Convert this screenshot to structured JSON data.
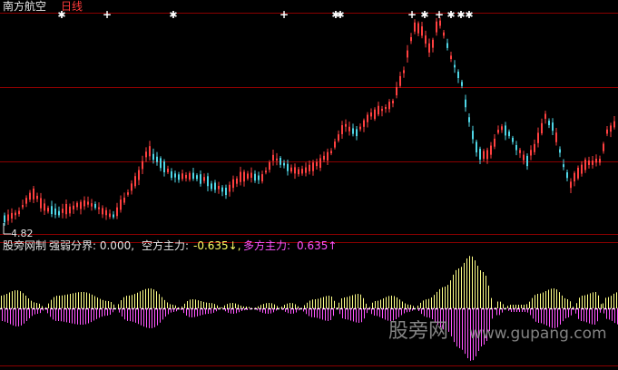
{
  "header": {
    "stock_name": "南方航空",
    "period": "日线"
  },
  "indicator": {
    "name": "股旁网制",
    "threshold_label": "强弱分界: 0.000,",
    "kong_label": "空方主力:",
    "kong_value": "-0.635↓,",
    "duo_label": "多方主力:",
    "duo_value": "0.635↑"
  },
  "price_low_label": "4.82",
  "watermark": {
    "text": "股旁网",
    "url": "www.gupang.com"
  },
  "colors": {
    "background": "#000000",
    "up_candle": "#ff4040",
    "down_candle": "#4fd6e6",
    "grid": "#8b0000",
    "kong_bars": "#ffff88",
    "duo_bars": "#ff55ff",
    "signal_marks": "#ffffff"
  },
  "icons": {
    "signal_star": "asterisk-icon",
    "signal_plus": "plus-icon"
  }
}
